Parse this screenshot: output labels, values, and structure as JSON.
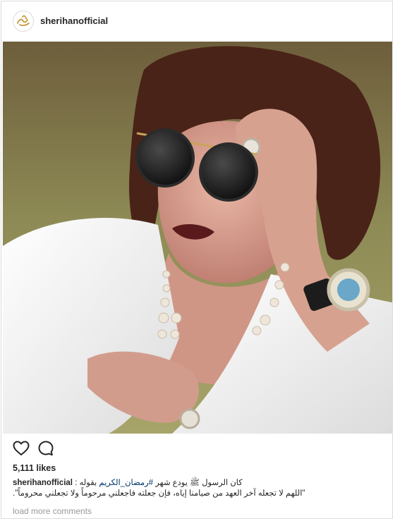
{
  "post": {
    "username": "sherihanofficial",
    "likes": "5,111 likes",
    "caption_username": "sherihanofficial",
    "caption_line1_pre": "كان الرسول ﷺ يودع شهر ",
    "caption_hashtag": "#رمضان_الكريم",
    "caption_line1_post": " بقوله :",
    "caption_line2": "\"اللهم لا تجعله آخر العهد من صيامنا إياه، فإن جعلته فاجعلني مرحوماً ولا تجعلني محروماً\".",
    "load_more": "load more comments"
  },
  "icons": {
    "like": "heart-outline-icon",
    "comment": "speech-bubble-icon"
  },
  "colors": {
    "border": "#dbdbdb",
    "text": "#262626",
    "muted": "#999999"
  }
}
